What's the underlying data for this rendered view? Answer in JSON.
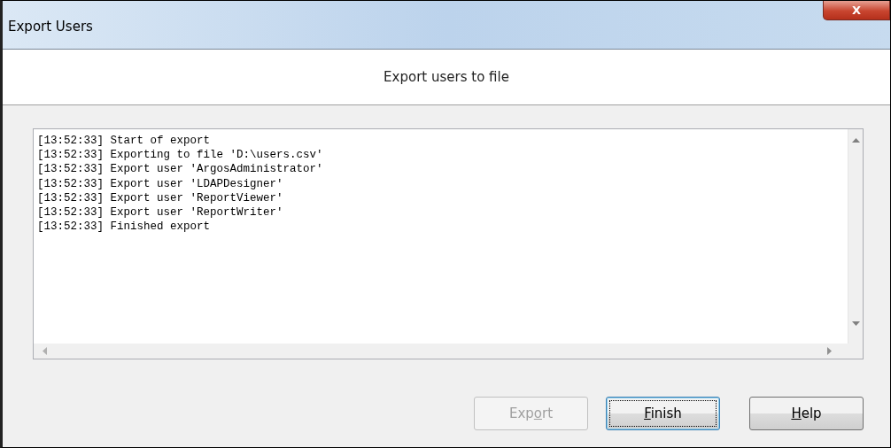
{
  "window": {
    "title": "Export Users",
    "close_glyph": "X"
  },
  "header": {
    "title": "Export users to file"
  },
  "log": {
    "lines": [
      "[13:52:33] Start of export",
      "[13:52:33] Exporting to file 'D:\\users.csv'",
      "[13:52:33] Export user 'ArgosAdministrator'",
      "[13:52:33] Export user 'LDAPDesigner'",
      "[13:52:33] Export user 'ReportViewer'",
      "[13:52:33] Export user 'ReportWriter'",
      "[13:52:33] Finished export"
    ]
  },
  "buttons": [
    {
      "label": [
        {
          "text": "Exp",
          "underlined": false
        },
        {
          "text": "o",
          "underlined": true
        },
        {
          "text": "rt",
          "underlined": false
        }
      ],
      "disabled": true,
      "focused": false
    },
    {
      "label": [
        {
          "text": "F",
          "underlined": true
        },
        {
          "text": "inish",
          "underlined": false
        }
      ],
      "disabled": false,
      "focused": true
    },
    {
      "label": [
        {
          "text": "H",
          "underlined": true
        },
        {
          "text": "elp",
          "underlined": false
        }
      ],
      "disabled": false,
      "focused": false
    }
  ]
}
